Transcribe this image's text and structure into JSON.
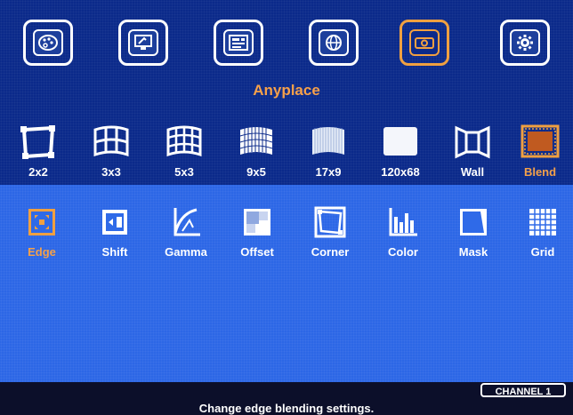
{
  "top_menu": {
    "items": [
      {
        "icon": "palette-icon"
      },
      {
        "icon": "monitor-settings-icon"
      },
      {
        "icon": "video-wall-icon"
      },
      {
        "icon": "globe-icon"
      },
      {
        "icon": "projector-icon"
      },
      {
        "icon": "gear-icon"
      }
    ],
    "active_index": 4,
    "accent_color": "#f0a040"
  },
  "section_title": "Anyplace",
  "layout_row": [
    {
      "label": "2x2",
      "icon": "corner-4point-icon"
    },
    {
      "label": "3x3",
      "icon": "warp-3x3-icon"
    },
    {
      "label": "5x3",
      "icon": "warp-5x3-icon"
    },
    {
      "label": "9x5",
      "icon": "warp-9x5-icon"
    },
    {
      "label": "17x9",
      "icon": "warp-17x9-icon"
    },
    {
      "label": "120x68",
      "icon": "warp-120x68-icon"
    },
    {
      "label": "Wall",
      "icon": "wall-icon"
    },
    {
      "label": "Blend",
      "icon": "blend-icon",
      "active": true
    }
  ],
  "blend_row": [
    {
      "label": "Edge",
      "icon": "edge-icon",
      "active": true
    },
    {
      "label": "Shift",
      "icon": "shift-icon"
    },
    {
      "label": "Gamma",
      "icon": "gamma-icon"
    },
    {
      "label": "Offset",
      "icon": "offset-icon"
    },
    {
      "label": "Corner",
      "icon": "corner-icon"
    },
    {
      "label": "Color",
      "icon": "color-bars-icon"
    },
    {
      "label": "Mask",
      "icon": "mask-icon"
    },
    {
      "label": "Grid",
      "icon": "grid-icon"
    }
  ],
  "status": {
    "message": "Change edge blending settings.",
    "channel": "CHANNEL 1"
  },
  "colors": {
    "top_bg": "#0b2a8a",
    "bottom_bg": "#2c67e6",
    "status_bg": "#0c0f2a",
    "accent": "#f3a04a"
  }
}
